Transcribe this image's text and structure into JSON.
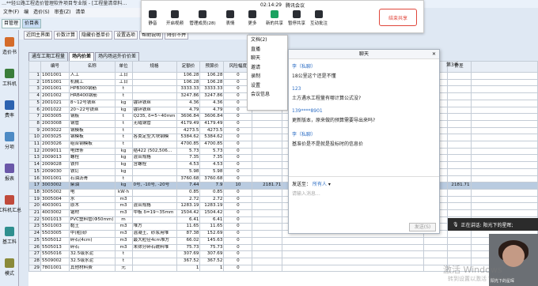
{
  "app_title": "…**轻公路工程造价管理软件项目专业版 - [工程量清单料…",
  "menu": [
    "文件(F)",
    "编",
    "造价(S)",
    "审查(Z)",
    "清单"
  ],
  "toolbar": {
    "active_tab": "价目表",
    "file_tab": "目管理"
  },
  "left_nav": [
    {
      "label": "造价书",
      "icon": "book-icon"
    },
    {
      "label": "工料机",
      "icon": "materials-icon"
    },
    {
      "label": "费率",
      "icon": "rate-icon"
    },
    {
      "label": "分项",
      "icon": "item-icon"
    },
    {
      "label": "报表",
      "icon": "report-icon"
    },
    {
      "label": "工料机汇总",
      "icon": "summary-icon"
    },
    {
      "label": "基工料",
      "icon": "base-icon"
    },
    {
      "label": "模式",
      "icon": "mode-icon"
    }
  ],
  "sub_toolbar": [
    "近回主界面",
    "价数计算",
    "隐藏价基单价",
    "设置选项",
    "帮助说明",
    "降价不并"
  ],
  "tabs": [
    "通车工期工程量",
    "场内价差",
    "场内场运外价价差"
  ],
  "table": {
    "headers": [
      "编号",
      "名称",
      "单位",
      "规格",
      "定额价",
      "预算价",
      "风险幅度"
    ],
    "right_header": "第3季",
    "right_subheaders": [
      "单位",
      "价差"
    ],
    "selected_row": 16,
    "rows": [
      [
        "1",
        "1001001",
        "人工",
        "工日",
        "",
        "106.28",
        "106.28",
        "0",
        "",
        ""
      ],
      [
        "2",
        "1051001",
        "机械工",
        "工日",
        "",
        "106.28",
        "106.28",
        "0",
        "",
        ""
      ],
      [
        "3",
        "2001001",
        "HPB300钢筋",
        "t",
        "",
        "3333.33",
        "3333.33",
        "0",
        "",
        ""
      ],
      [
        "4",
        "2001002",
        "HRB400钢筋",
        "t",
        "",
        "3247.86",
        "3247.86",
        "0",
        "",
        ""
      ],
      [
        "5",
        "2001021",
        "8~12号铁丝",
        "kg",
        "镀锌铁丝",
        "4.36",
        "4.36",
        "0",
        "",
        ""
      ],
      [
        "6",
        "2001022",
        "20~22号铁丝",
        "kg",
        "镀锌铁丝",
        "4.79",
        "4.79",
        "0",
        "",
        ""
      ],
      [
        "7",
        "2003005",
        "钢板",
        "t",
        "Q235, δ=5~40mm",
        "3606.84",
        "3606.84",
        "0",
        "",
        ""
      ],
      [
        "8",
        "2003008",
        "钢管",
        "t",
        "无缝钢管",
        "4179.49",
        "4179.49",
        "0",
        "",
        ""
      ],
      [
        "9",
        "2003022",
        "钢模板",
        "t",
        "",
        "4273.5",
        "4273.5",
        "0",
        "",
        ""
      ],
      [
        "10",
        "2003025",
        "钢模板",
        "t",
        "各类定型大块钢模",
        "5384.62",
        "5384.62",
        "0",
        "",
        ""
      ],
      [
        "11",
        "2003026",
        "组合钢模板",
        "t",
        "",
        "4700.85",
        "4700.85",
        "0",
        "",
        ""
      ],
      [
        "12",
        "2009011",
        "电焊条",
        "kg",
        "结422 (502,506...",
        "5.73",
        "5.73",
        "0",
        "",
        ""
      ],
      [
        "13",
        "2009013",
        "螺栓",
        "kg",
        "混合规格",
        "7.35",
        "7.35",
        "0",
        "",
        ""
      ],
      [
        "14",
        "2009028",
        "铁件",
        "kg",
        "含螺栓",
        "4.53",
        "4.53",
        "0",
        "",
        ""
      ],
      [
        "15",
        "2009030",
        "铁钉",
        "kg",
        "",
        "5.98",
        "5.98",
        "0",
        "",
        ""
      ],
      [
        "16",
        "3001001",
        "石油沥青",
        "t",
        "",
        "3760.68",
        "3760.68",
        "0",
        "",
        ""
      ],
      [
        "17",
        "3003002",
        "柴油",
        "kg",
        "0号, -10号, -20号",
        "7.44",
        "7.9",
        "10",
        "2181.71",
        "2181.71"
      ],
      [
        "18",
        "3005002",
        "电",
        "kW·h",
        "",
        "0.85",
        "0.85",
        "0",
        "",
        ""
      ],
      [
        "19",
        "3005004",
        "水",
        "m3",
        "",
        "2.72",
        "2.72",
        "0",
        "",
        ""
      ],
      [
        "20",
        "4003001",
        "原木",
        "m3",
        "混合规格",
        "1283.19",
        "1283.19",
        "0",
        "",
        ""
      ],
      [
        "21",
        "4003002",
        "锯材",
        "m3",
        "中板 δ=19~35mm",
        "1504.42",
        "1504.42",
        "0",
        "",
        ""
      ],
      [
        "22",
        "5001013",
        "PVC塑料管(Φ50mm)",
        "m",
        "",
        "6.41",
        "6.41",
        "0",
        "",
        ""
      ],
      [
        "23",
        "5501003",
        "黏土",
        "m3",
        "堆方",
        "11.65",
        "11.65",
        "0",
        "",
        ""
      ],
      [
        "24",
        "5503005",
        "中(粗)砂",
        "m3",
        "混凝土、砂浆用堆",
        "87.38",
        "152.69",
        "0",
        "",
        ""
      ],
      [
        "25",
        "5505012",
        "碎石(4cm)",
        "m3",
        "最大粒径4cm堆方",
        "66.02",
        "145.63",
        "0",
        "",
        ""
      ],
      [
        "26",
        "5505013",
        "碎石",
        "m3",
        "未筛分碎石统料堆",
        "75.73",
        "75.73",
        "0",
        "",
        ""
      ],
      [
        "27",
        "5505016",
        "32.5级水泥",
        "t",
        "",
        "307.69",
        "307.69",
        "0",
        "",
        ""
      ],
      [
        "28",
        "5509002",
        "32.5级水泥",
        "t",
        "",
        "367.52",
        "367.52",
        "0",
        "",
        ""
      ],
      [
        "29",
        "7801001",
        "其他材料费",
        "元",
        "",
        "1",
        "1",
        "0",
        "",
        ""
      ]
    ]
  },
  "meeting": {
    "time": "02:14:29",
    "name": "腾讯会议",
    "buttons": [
      {
        "label": "静音",
        "icon": "microphone-icon"
      },
      {
        "label": "开启视频",
        "icon": "camera-icon"
      },
      {
        "label": "管理成员(28)",
        "icon": "members-icon"
      },
      {
        "label": "表情",
        "icon": "emoji-icon"
      },
      {
        "label": "更多",
        "icon": "more-icon"
      },
      {
        "label": "新的共享",
        "icon": "share-icon"
      },
      {
        "label": "暂停共享",
        "icon": "pause-icon"
      },
      {
        "label": "互动批注",
        "icon": "annotate-icon"
      }
    ],
    "end_share": "结束共享"
  },
  "more_menu": [
    "文档(2)",
    "直播",
    "聊天",
    "邀请",
    "录制",
    "设置",
    "会议信息"
  ],
  "chat": {
    "title": "聊天",
    "messages": [
      {
        "sender": "李（私聊）",
        "text": "18公里这个还是不懂"
      },
      {
        "sender": "123",
        "text": "土方遇水工程量有哪计算公式没?"
      },
      {
        "sender": "139****8901",
        "text": "更新版本，原来做的预算需要导出来吗?"
      },
      {
        "sender": "李（私聊）",
        "text": "基准价是不是就是投标时的信息价"
      }
    ],
    "send_to_label": "发送至：",
    "send_to_value": "所有人",
    "input_placeholder": "请输入消息...",
    "send_button": "发送(S)"
  },
  "speaker": "正在讲话: 阳光下的星晖;",
  "watermark": {
    "line1": "激活 Windows",
    "line2": "转到设置以激活 Windows。"
  },
  "video_label": "阳光下的星晖"
}
